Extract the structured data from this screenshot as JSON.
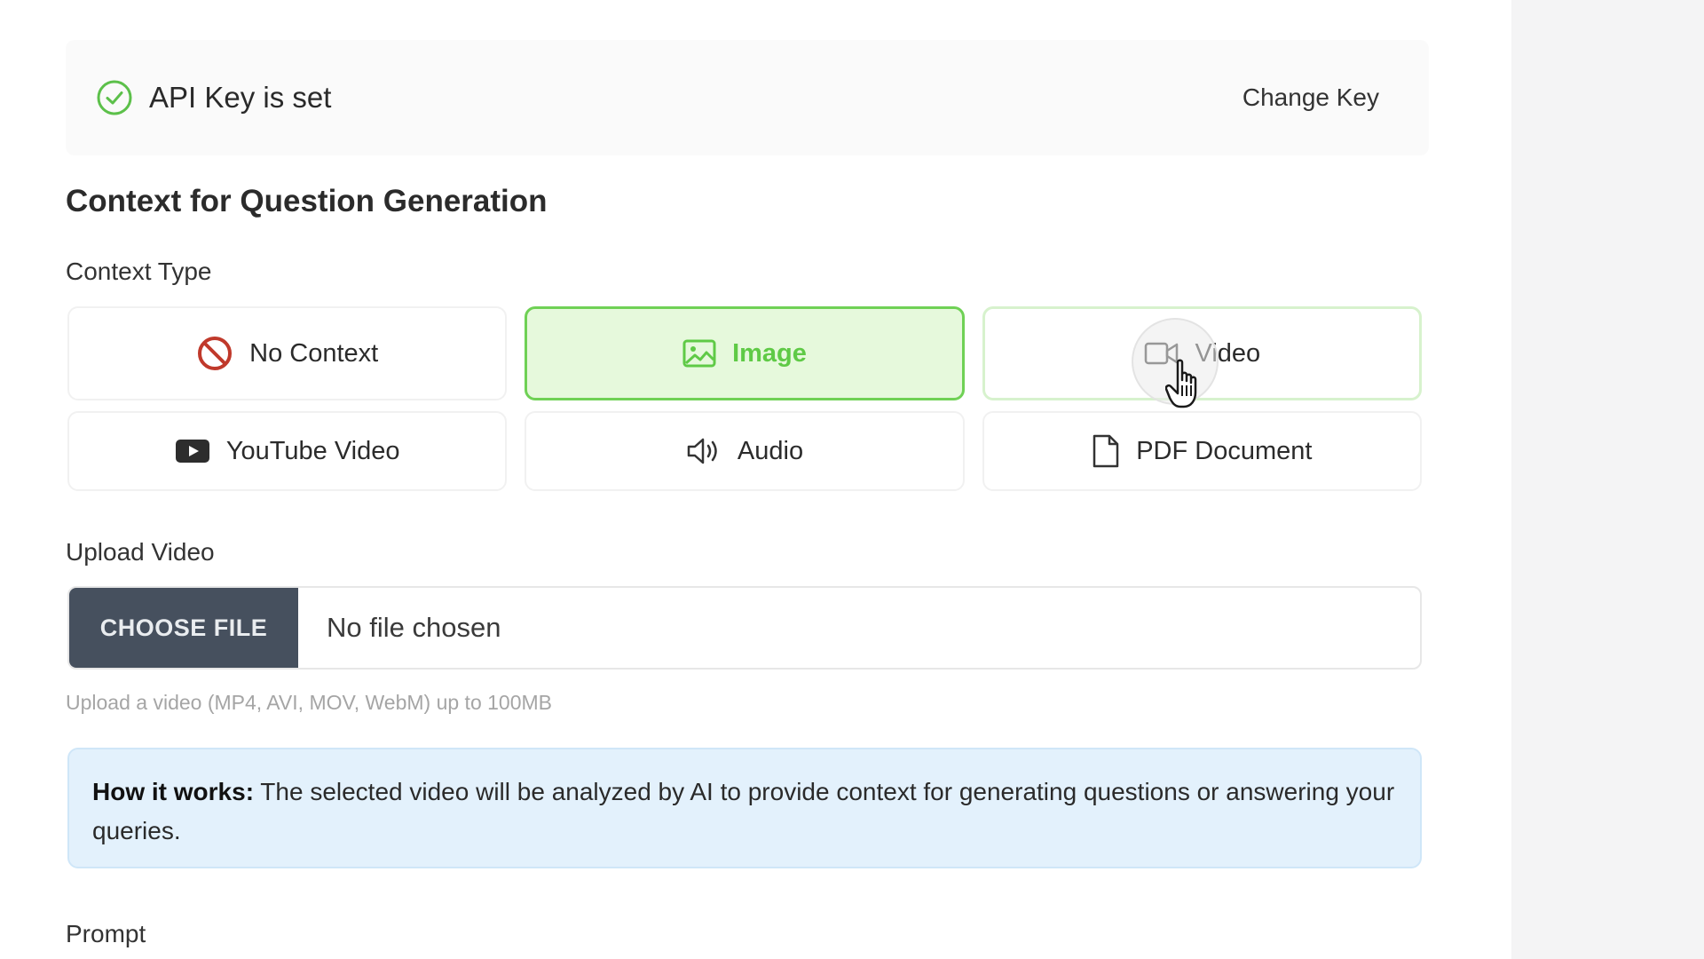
{
  "api": {
    "status_text": "API Key is set",
    "change_key_label": "Change Key",
    "status_color": "#5cc04a"
  },
  "section_title": "Context for Question Generation",
  "context_type": {
    "label": "Context Type",
    "selected": "Image",
    "options": [
      {
        "label": "No Context",
        "icon": "no-entry-icon"
      },
      {
        "label": "Image",
        "icon": "image-icon"
      },
      {
        "label": "Video",
        "icon": "video-camera-icon"
      },
      {
        "label": "YouTube Video",
        "icon": "youtube-icon"
      },
      {
        "label": "Audio",
        "icon": "speaker-icon"
      },
      {
        "label": "PDF Document",
        "icon": "document-icon"
      }
    ]
  },
  "upload": {
    "label": "Upload Video",
    "button_label": "CHOOSE FILE",
    "file_status": "No file chosen",
    "help": "Upload a video (MP4, AVI, MOV, WebM) up to 100MB"
  },
  "info": {
    "lead": "How it works:",
    "text": " The selected video will be analyzed by AI to provide context for generating questions or answering your queries."
  },
  "prompt_label": "Prompt",
  "colors": {
    "accent_green": "#6fd155",
    "selected_bg": "#e6f9dc",
    "button_dark": "#46505e",
    "info_bg": "#e3f1fc",
    "no_context_red": "#c0392b",
    "youtube_dark": "#2d2d2d"
  }
}
